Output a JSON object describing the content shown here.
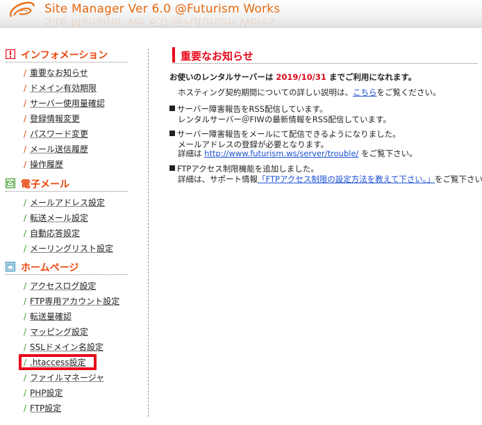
{
  "header": {
    "title": "Site Manager Ver 6.0 @Futurism Works",
    "logo": "swirl-logo-icon",
    "accent_color": "#e86a10"
  },
  "sidebar": {
    "sections": [
      {
        "title": "インフォメーション",
        "icon": "exclamation-box-icon",
        "items": [
          "重要なお知らせ",
          "ドメイン有効期限",
          "サーバー使用量確認",
          "登録情報変更",
          "パスワード変更",
          "メール送信履歴",
          "操作履歴"
        ]
      },
      {
        "title": "電子メール",
        "icon": "envelope-icon",
        "items": [
          "メールアドレス設定",
          "転送メール設定",
          "自動応答設定",
          "メーリングリスト設定"
        ]
      },
      {
        "title": "ホームページ",
        "icon": "window-icon",
        "items": [
          ".htaccess設定"
        ]
      }
    ],
    "homepage_items": [
      "アクセスログ設定",
      "FTP専用アカウント設定",
      "転送量確認",
      "マッピング設定",
      "SSLドメイン名設定",
      ".htaccess設定",
      "ファイルマネージャ",
      "PHP設定",
      "FTP設定"
    ],
    "highlighted_item": ".htaccess設定",
    "highlight_color": "#e8081a"
  },
  "main": {
    "heading": "重要なお知らせ",
    "notice_prefix": "お使いのレンタルサーバーは",
    "notice_date": "2019/10/31",
    "notice_suffix": "までご利用になれます。",
    "hosting_text_pre": "ホスティング契約期間についての詳しい説明は、",
    "hosting_link": "こちら",
    "hosting_text_post": "をご覧ください。",
    "rss_title": "サーバー障害報告をRSS配信しています。",
    "rss_detail": "レンタルサーバー＠FIWの最新情報をRSS配信しています。",
    "mail_title": "サーバー障害報告をメールにて配信できるようになりました。",
    "mail_detail": "メールアドレスの登録が必要となります。",
    "mail_detail2_pre": "詳細は",
    "mail_detail2_link": "http://www.futurism.ws/server/trouble/",
    "mail_detail2_post": "をご覧下さい。",
    "ftp_title": "FTPアクセス制限機能を追加しました。",
    "ftp_detail_pre": "詳細は、サポート情報",
    "ftp_detail_link": "「FTPアクセス制限の設定方法を教えて下さい。」",
    "ftp_detail_post": "をご覧下さい。",
    "date_color": "#d8081a",
    "link_color": "#1a4fd6"
  }
}
